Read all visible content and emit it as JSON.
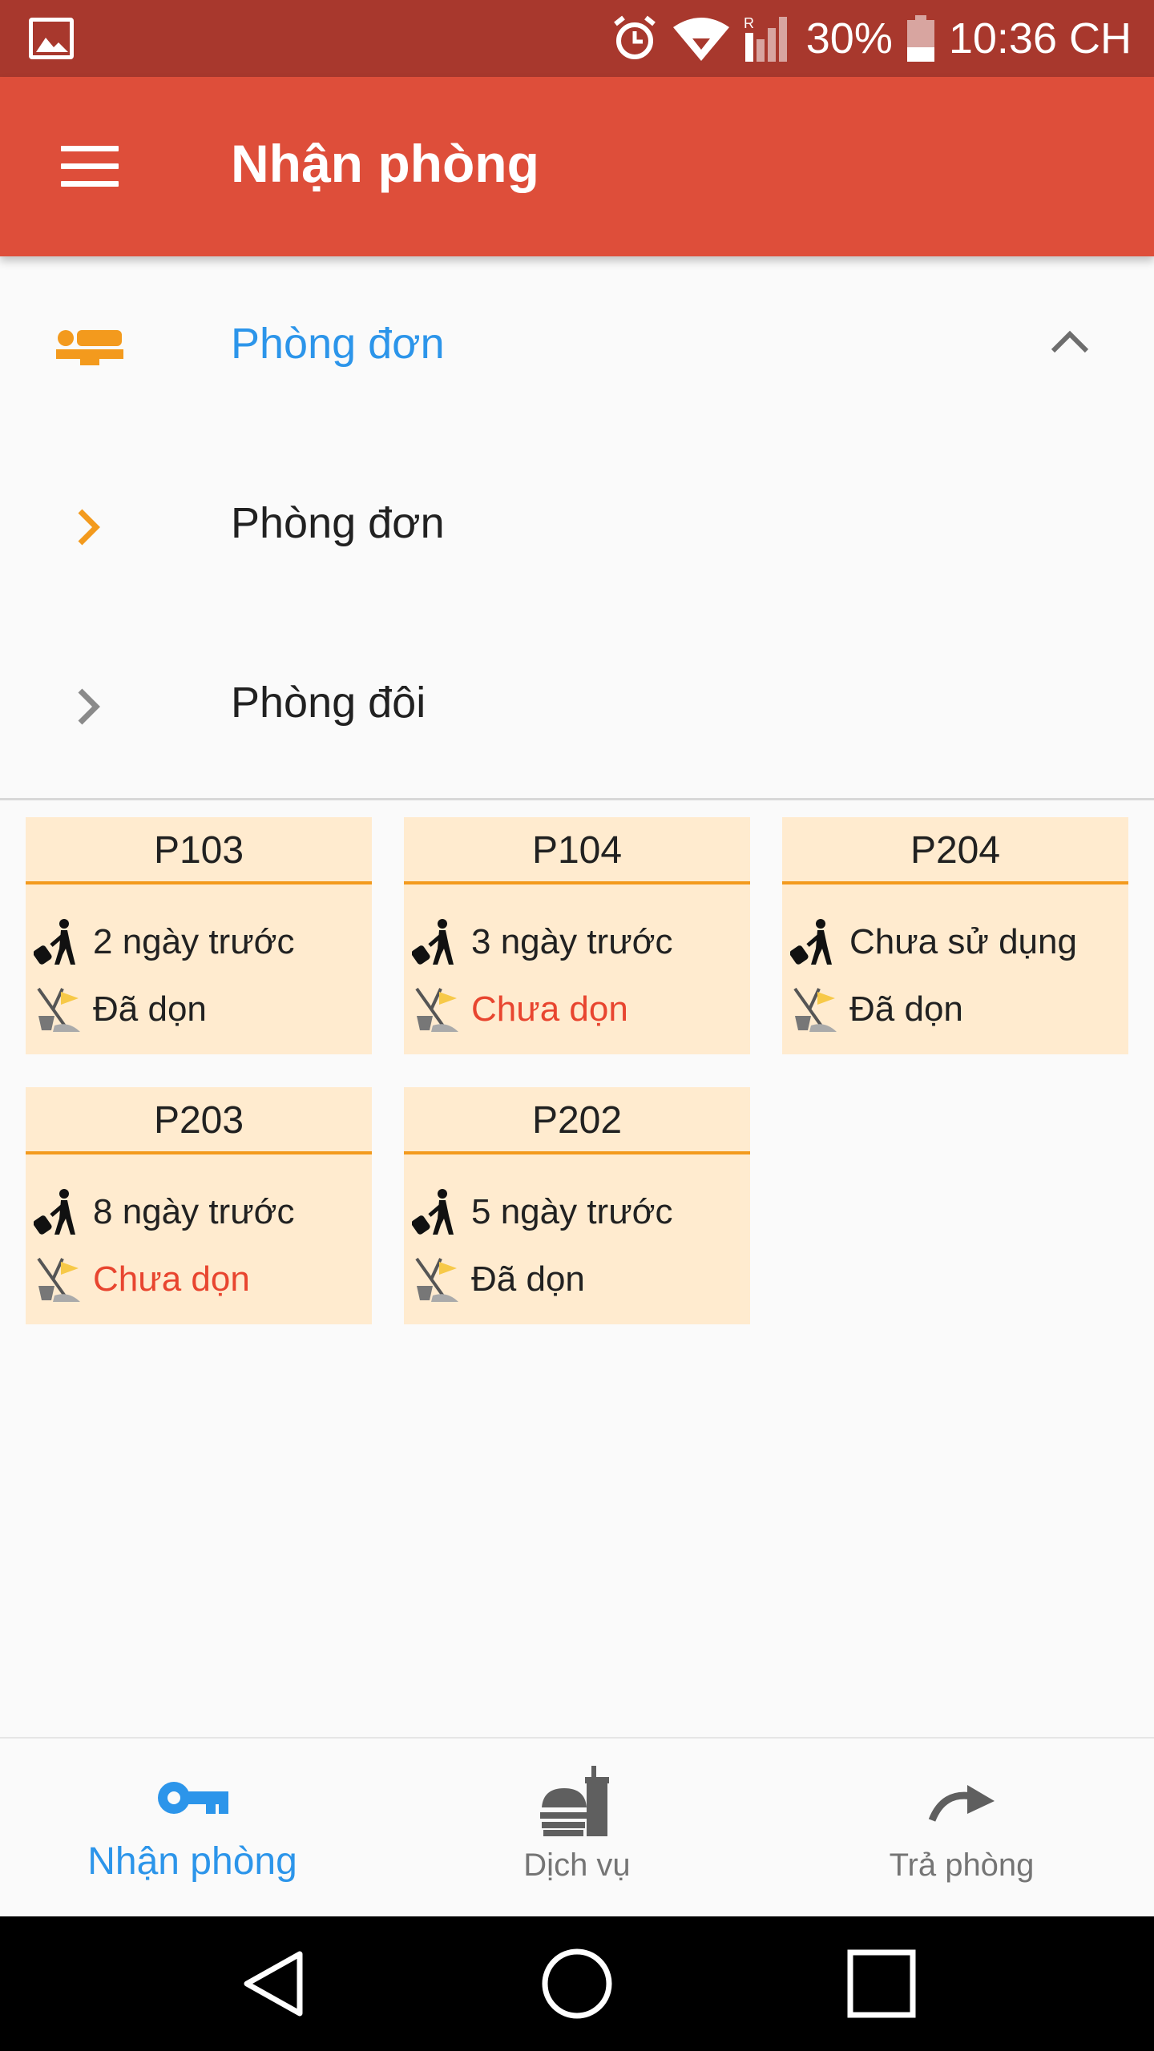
{
  "status_bar": {
    "battery": "30%",
    "time": "10:36 CH",
    "icons": [
      "gallery-icon",
      "alarm-icon",
      "wifi-icon",
      "signal-icon",
      "battery-icon"
    ]
  },
  "app_bar": {
    "title": "Nhận phòng",
    "menu_icon": "menu-icon"
  },
  "categories": {
    "header": {
      "label": "Phòng đơn",
      "icon": "bed-icon",
      "expanded": true
    },
    "items": [
      {
        "label": "Phòng đơn",
        "selected": true
      },
      {
        "label": "Phòng đôi",
        "selected": false
      }
    ]
  },
  "rooms": [
    {
      "name": "P103",
      "checkin": "2 ngày trước",
      "cleaning": "Đã dọn",
      "clean": true
    },
    {
      "name": "P104",
      "checkin": "3 ngày trước",
      "cleaning": "Chưa dọn",
      "clean": false
    },
    {
      "name": "P204",
      "checkin": "Chưa sử dụng",
      "cleaning": "Đã dọn",
      "clean": true
    },
    {
      "name": "P203",
      "checkin": "8 ngày trước",
      "cleaning": "Chưa dọn",
      "clean": false
    },
    {
      "name": "P202",
      "checkin": "5 ngày trước",
      "cleaning": "Đã dọn",
      "clean": true
    }
  ],
  "bottom_nav": [
    {
      "label": "Nhận phòng",
      "icon": "key-icon",
      "active": true
    },
    {
      "label": "Dịch vụ",
      "icon": "food-service-icon",
      "active": false
    },
    {
      "label": "Trả phòng",
      "icon": "redo-arrow-icon",
      "active": false
    }
  ],
  "colors": {
    "status_bar": "#a8382d",
    "app_bar": "#de4e3a",
    "accent_blue": "#2c95ea",
    "accent_orange": "#f39a1d",
    "room_card": "#ffebcf",
    "dirty_text": "#e8452f"
  }
}
